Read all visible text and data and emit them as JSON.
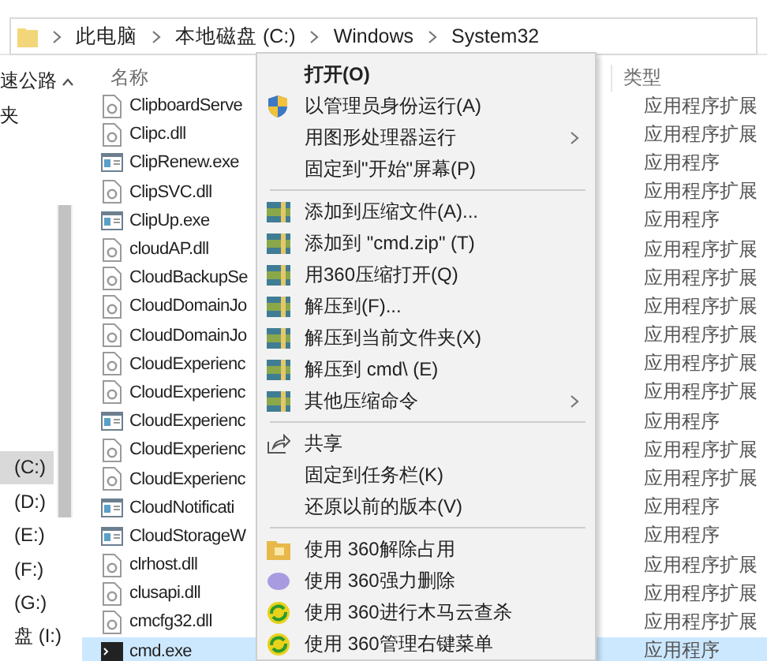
{
  "address_bar": {
    "crumbs": [
      "此电脑",
      "本地磁盘 (C:)",
      "Windows",
      "System32"
    ]
  },
  "nav_pane": {
    "items": [
      {
        "label": "速公路",
        "kind": "group",
        "expanded": true,
        "selected": false
      },
      {
        "label": "夹",
        "kind": "folder",
        "selected": false
      },
      {
        "label": "(C:)",
        "kind": "drive",
        "selected": true
      },
      {
        "label": "(D:)",
        "kind": "drive",
        "selected": false
      },
      {
        "label": "(E:)",
        "kind": "drive",
        "selected": false
      },
      {
        "label": "(F:)",
        "kind": "drive",
        "selected": false
      },
      {
        "label": "(G:)",
        "kind": "drive",
        "selected": false
      },
      {
        "label": "盘 (I:)",
        "kind": "drive",
        "selected": false
      }
    ]
  },
  "file_list": {
    "columns": [
      "名称",
      "类型"
    ],
    "rows": [
      {
        "name": "ClipboardServe",
        "type": "应用程序扩展",
        "kind": "library",
        "selected": false
      },
      {
        "name": "Clipc.dll",
        "type": "应用程序扩展",
        "kind": "library",
        "selected": false
      },
      {
        "name": "ClipRenew.exe",
        "type": "应用程序",
        "kind": "app",
        "selected": false
      },
      {
        "name": "ClipSVC.dll",
        "type": "应用程序扩展",
        "kind": "library",
        "selected": false
      },
      {
        "name": "ClipUp.exe",
        "type": "应用程序",
        "kind": "app",
        "selected": false
      },
      {
        "name": "cloudAP.dll",
        "type": "应用程序扩展",
        "kind": "library",
        "selected": false
      },
      {
        "name": "CloudBackupSe",
        "type": "应用程序扩展",
        "kind": "library",
        "selected": false
      },
      {
        "name": "CloudDomainJo",
        "type": "应用程序扩展",
        "kind": "library",
        "selected": false
      },
      {
        "name": "CloudDomainJo",
        "type": "应用程序扩展",
        "kind": "library",
        "selected": false
      },
      {
        "name": "CloudExperienc",
        "type": "应用程序扩展",
        "kind": "library",
        "selected": false
      },
      {
        "name": "CloudExperienc",
        "type": "应用程序扩展",
        "kind": "library",
        "selected": false
      },
      {
        "name": "CloudExperienc",
        "type": "应用程序",
        "kind": "app",
        "selected": false
      },
      {
        "name": "CloudExperienc",
        "type": "应用程序扩展",
        "kind": "library",
        "selected": false
      },
      {
        "name": "CloudExperienc",
        "type": "应用程序扩展",
        "kind": "library",
        "selected": false
      },
      {
        "name": "CloudNotificati",
        "type": "应用程序",
        "kind": "app",
        "selected": false
      },
      {
        "name": "CloudStorageW",
        "type": "应用程序",
        "kind": "app",
        "selected": false
      },
      {
        "name": "clrhost.dll",
        "type": "应用程序扩展",
        "kind": "library",
        "selected": false
      },
      {
        "name": "clusapi.dll",
        "type": "应用程序扩展",
        "kind": "library",
        "selected": false
      },
      {
        "name": "cmcfg32.dll",
        "type": "应用程序扩展",
        "kind": "library",
        "selected": false
      },
      {
        "name": "cmd.exe",
        "type": "应用程序",
        "kind": "console",
        "selected": true
      }
    ]
  },
  "context_menu": {
    "groups": [
      [
        {
          "label": "打开(O)",
          "kind": "plain",
          "default": true,
          "submenu": false
        },
        {
          "label": "以管理员身份运行(A)",
          "kind": "shield",
          "default": false,
          "submenu": false
        },
        {
          "label": "用图形处理器运行",
          "kind": "plain",
          "default": false,
          "submenu": true
        },
        {
          "label": "固定到\"开始\"屏幕(P)",
          "kind": "plain",
          "default": false,
          "submenu": false
        }
      ],
      [
        {
          "label": "添加到压缩文件(A)...",
          "kind": "archive",
          "default": false,
          "submenu": false
        },
        {
          "label": "添加到 \"cmd.zip\" (T)",
          "kind": "archive",
          "default": false,
          "submenu": false
        },
        {
          "label": "用360压缩打开(Q)",
          "kind": "archive",
          "default": false,
          "submenu": false
        },
        {
          "label": "解压到(F)...",
          "kind": "archive",
          "default": false,
          "submenu": false
        },
        {
          "label": "解压到当前文件夹(X)",
          "kind": "archive",
          "default": false,
          "submenu": false
        },
        {
          "label": "解压到 cmd\\ (E)",
          "kind": "archive",
          "default": false,
          "submenu": false
        },
        {
          "label": "其他压缩命令",
          "kind": "archive",
          "default": false,
          "submenu": true
        }
      ],
      [
        {
          "label": "共享",
          "kind": "share",
          "default": false,
          "submenu": false
        },
        {
          "label": "固定到任务栏(K)",
          "kind": "plain",
          "default": false,
          "submenu": false
        },
        {
          "label": "还原以前的版本(V)",
          "kind": "plain",
          "default": false,
          "submenu": false
        }
      ],
      [
        {
          "label": "使用 360解除占用",
          "kind": "unlock",
          "default": false,
          "submenu": false
        },
        {
          "label": "使用 360强力删除",
          "kind": "shred",
          "default": false,
          "submenu": false
        },
        {
          "label": "使用 360进行木马云查杀",
          "kind": "guard",
          "default": false,
          "submenu": false
        },
        {
          "label": "使用 360管理右键菜单",
          "kind": "guard",
          "default": false,
          "submenu": false
        }
      ]
    ]
  }
}
